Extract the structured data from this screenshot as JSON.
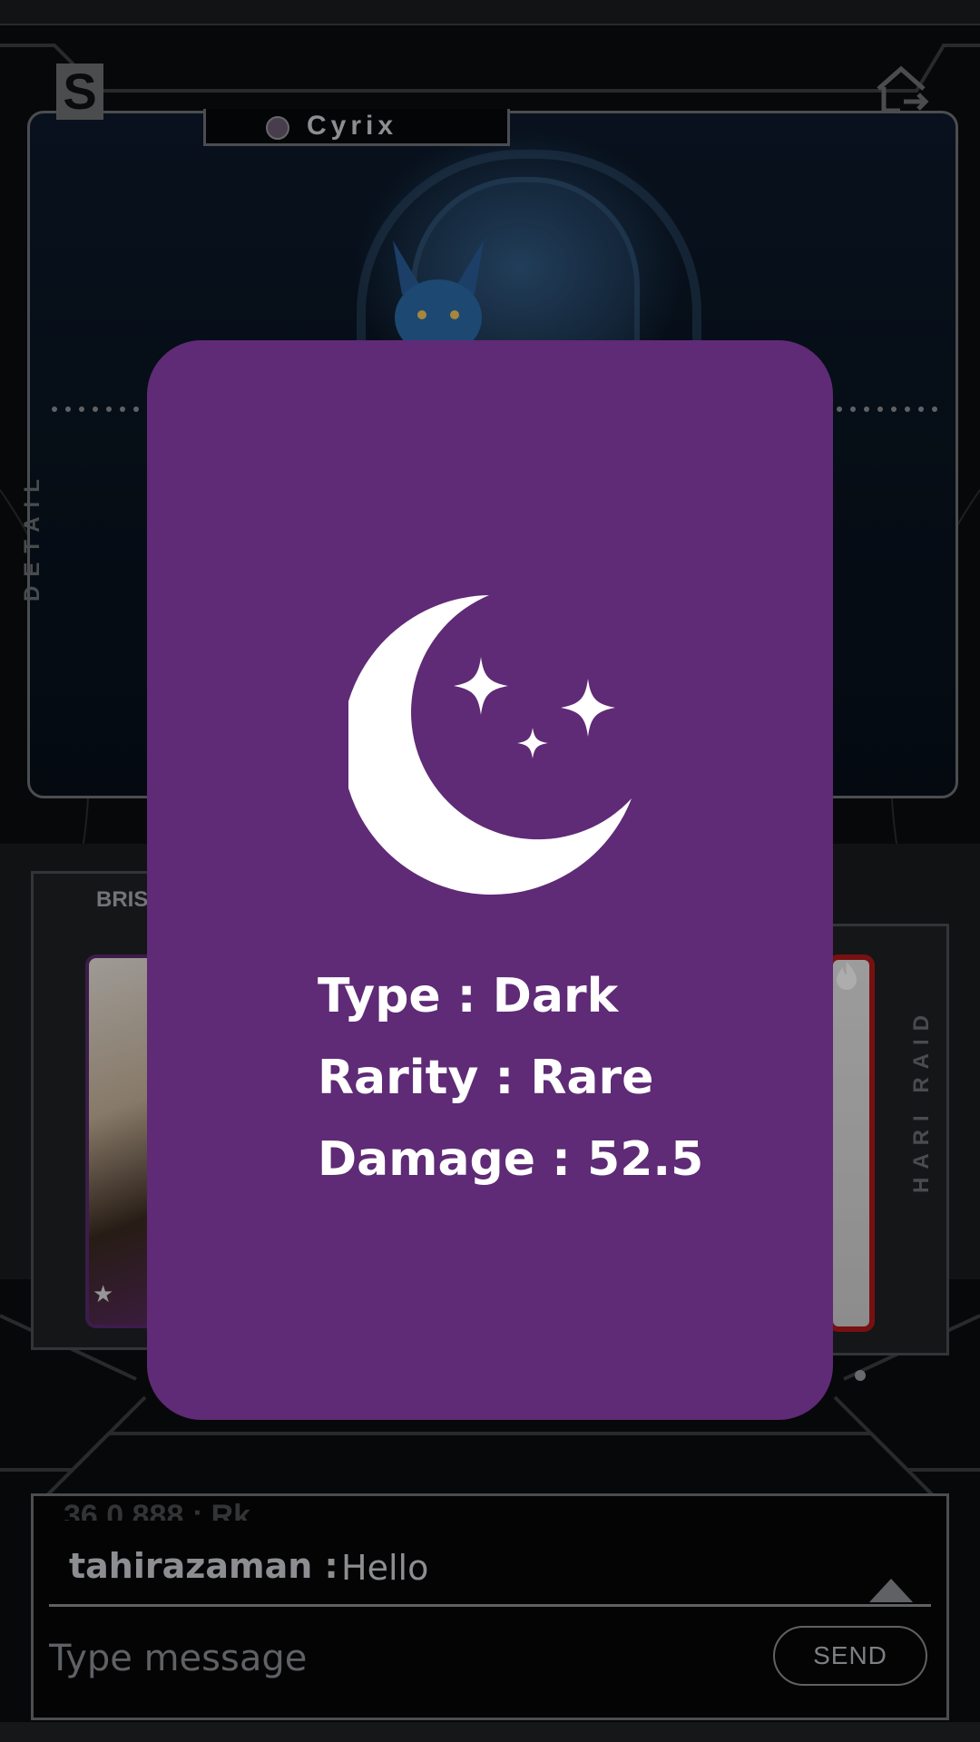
{
  "header": {
    "logo_letter": "S",
    "character_name": "Cyrix"
  },
  "side_labels": {
    "left": "DETAIL",
    "right": "HARI RAID"
  },
  "cards_section": {
    "left_label": "BRIS"
  },
  "chat": {
    "ghost_message": "36.0.888 : Rk",
    "last_message": {
      "user": "tahirazaman :",
      "text": "Hello"
    },
    "input_placeholder": "Type message",
    "send_label": "SEND"
  },
  "modal": {
    "icon": "moon-stars-icon",
    "type_line": "Type : Dark",
    "rarity_line": "Rarity : Rare",
    "damage_line": "Damage : 52.5",
    "background_color": "#5f2a76"
  },
  "colors": {
    "frame_gray": "#6f7276",
    "text_light": "#cfd2d6",
    "accent_red": "#b01a1a"
  }
}
